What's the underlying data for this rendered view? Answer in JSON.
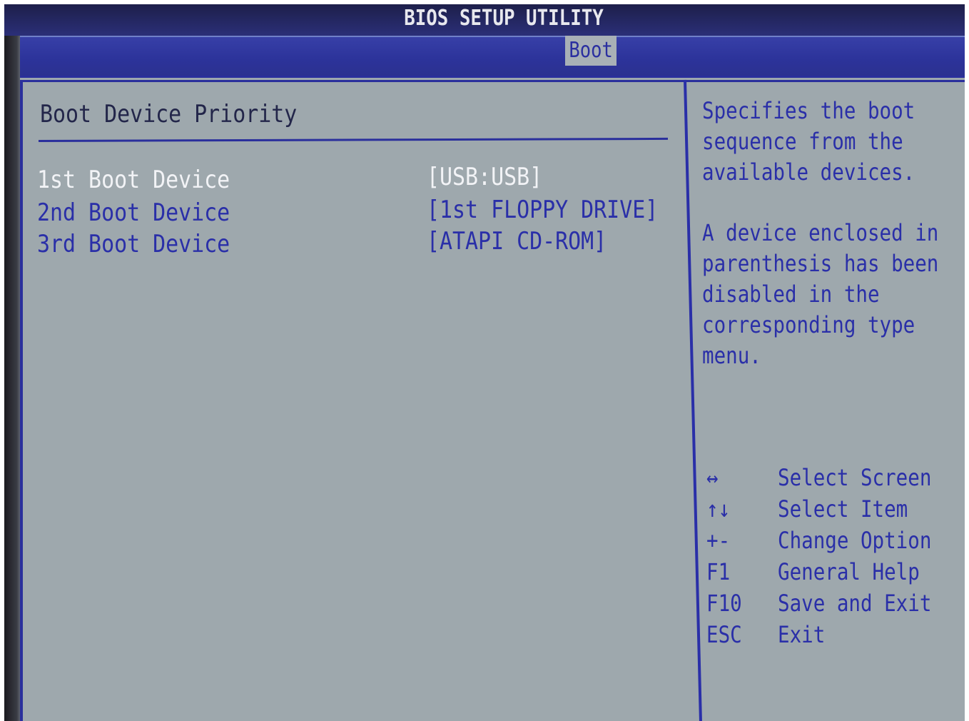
{
  "header": {
    "title": "BIOS SETUP UTILITY",
    "active_tab": "Boot"
  },
  "main": {
    "section_title": "Boot Device Priority",
    "boot_devices": [
      {
        "label": "1st Boot Device",
        "value": "[USB:USB]",
        "selected": true
      },
      {
        "label": "2nd Boot Device",
        "value": "[1st FLOPPY DRIVE]",
        "selected": false
      },
      {
        "label": "3rd Boot Device",
        "value": "[ATAPI CD-ROM]",
        "selected": false
      }
    ]
  },
  "help": {
    "paragraph1": [
      "Specifies the boot",
      "sequence from the",
      "available devices."
    ],
    "paragraph2": [
      "A device enclosed in",
      "parenthesis has been",
      "disabled in the",
      "corresponding type",
      "menu."
    ]
  },
  "keys": [
    {
      "key": "↔",
      "desc": "Select Screen"
    },
    {
      "key": "↑↓",
      "desc": "Select Item"
    },
    {
      "key": "+-",
      "desc": "Change Option"
    },
    {
      "key": "F1",
      "desc": "General Help"
    },
    {
      "key": "F10",
      "desc": "Save and Exit"
    },
    {
      "key": "ESC",
      "desc": "Exit"
    }
  ],
  "colors": {
    "background": "#9ea8ad",
    "accent_blue": "#2a2fa8",
    "title_bar": "#1d1f4a",
    "selected_text": "#f2f3f6"
  }
}
